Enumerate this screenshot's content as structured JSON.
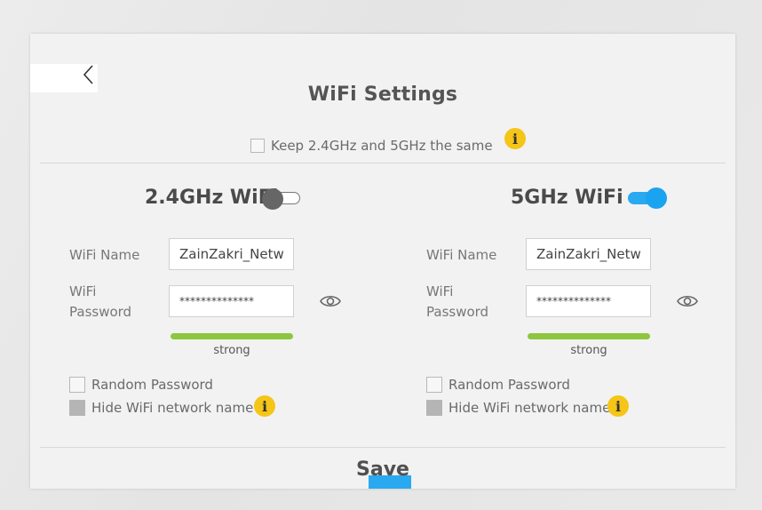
{
  "page": {
    "title": "WiFi Settings"
  },
  "keep_same": {
    "label": "Keep 2.4GHz and 5GHz the same",
    "checked": false
  },
  "band_24": {
    "title": "2.4GHz WiFi",
    "enabled": false,
    "name_label": "WiFi Name",
    "name_value": "ZainZakri_Netwo",
    "password_label_line1": "WiFi",
    "password_label_line2": "Password",
    "password_value": "**************",
    "strength": "strong",
    "strength_fraction": 1.0,
    "random_password_label": "Random Password",
    "hide_network_label": "Hide WiFi network name"
  },
  "band_5": {
    "title": "5GHz WiFi",
    "enabled": true,
    "name_label": "WiFi Name",
    "name_value": "ZainZakri_Netwo",
    "password_label_line1": "WiFi",
    "password_label_line2": "Password",
    "password_value": "**************",
    "strength": "strong",
    "strength_fraction": 1.0,
    "random_password_label": "Random Password",
    "hide_network_label": "Hide WiFi network name"
  },
  "actions": {
    "save_label": "Save"
  },
  "icons": {
    "back": "chevron-left-icon",
    "info": "info-icon",
    "eye": "eye-icon",
    "info_glyph": "i"
  },
  "colors": {
    "accent": "#29a9f0",
    "info": "#f5c518",
    "strength_strong": "#8dc63f",
    "toggle_off_knob": "#666666"
  }
}
